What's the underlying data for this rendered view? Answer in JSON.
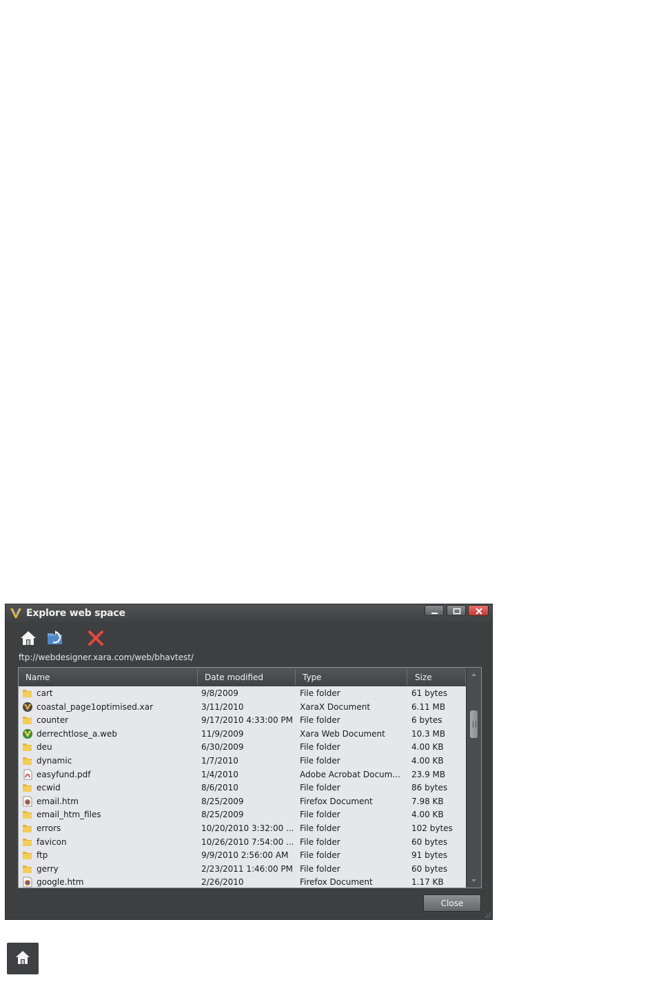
{
  "window": {
    "title": "Explore web space",
    "logo_icon": "xara-logo-icon",
    "controls": {
      "minimize": "minimize-icon",
      "maximize": "maximize-icon",
      "close": "close-icon"
    }
  },
  "toolbar": {
    "home_icon": "home-icon",
    "refresh_icon": "folder-refresh-icon",
    "delete_icon": "delete-icon"
  },
  "path": "ftp://webdesigner.xara.com/web/bhavtest/",
  "columns": {
    "name": "Name",
    "date": "Date modified",
    "type": "Type",
    "size": "Size"
  },
  "files": [
    {
      "name": "cart",
      "date": "9/8/2009",
      "type": "File folder",
      "size": "61 bytes",
      "icon": "folder"
    },
    {
      "name": "coastal_page1optimised.xar",
      "date": "3/11/2010",
      "type": "XaraX Document",
      "size": "6.11 MB",
      "icon": "xar"
    },
    {
      "name": "counter",
      "date": "9/17/2010 4:33:00 PM",
      "type": "File folder",
      "size": "6 bytes",
      "icon": "folder"
    },
    {
      "name": "derrechtlose_a.web",
      "date": "11/9/2009",
      "type": "Xara Web Document",
      "size": "10.3 MB",
      "icon": "web"
    },
    {
      "name": "deu",
      "date": "6/30/2009",
      "type": "File folder",
      "size": "4.00 KB",
      "icon": "folder"
    },
    {
      "name": "dynamic",
      "date": "1/7/2010",
      "type": "File folder",
      "size": "4.00 KB",
      "icon": "folder"
    },
    {
      "name": "easyfund.pdf",
      "date": "1/4/2010",
      "type": "Adobe Acrobat Docum...",
      "size": "23.9 MB",
      "icon": "pdf"
    },
    {
      "name": "ecwid",
      "date": "8/6/2010",
      "type": "File folder",
      "size": "86 bytes",
      "icon": "folder"
    },
    {
      "name": "email.htm",
      "date": "8/25/2009",
      "type": "Firefox Document",
      "size": "7.98 KB",
      "icon": "htm"
    },
    {
      "name": "email_htm_files",
      "date": "8/25/2009",
      "type": "File folder",
      "size": "4.00 KB",
      "icon": "folder"
    },
    {
      "name": "errors",
      "date": "10/20/2010 3:32:00 ...",
      "type": "File folder",
      "size": "102 bytes",
      "icon": "folder"
    },
    {
      "name": "favicon",
      "date": "10/26/2010 7:54:00 ...",
      "type": "File folder",
      "size": "60 bytes",
      "icon": "folder"
    },
    {
      "name": "ftp",
      "date": "9/9/2010 2:56:00 AM",
      "type": "File folder",
      "size": "91 bytes",
      "icon": "folder"
    },
    {
      "name": "gerry",
      "date": "2/23/2011 1:46:00 PM",
      "type": "File folder",
      "size": "60 bytes",
      "icon": "folder"
    },
    {
      "name": "google.htm",
      "date": "2/26/2010",
      "type": "Firefox Document",
      "size": "1.17 KB",
      "icon": "htm"
    }
  ],
  "buttons": {
    "close": "Close"
  },
  "standalone_icon": "home-icon"
}
